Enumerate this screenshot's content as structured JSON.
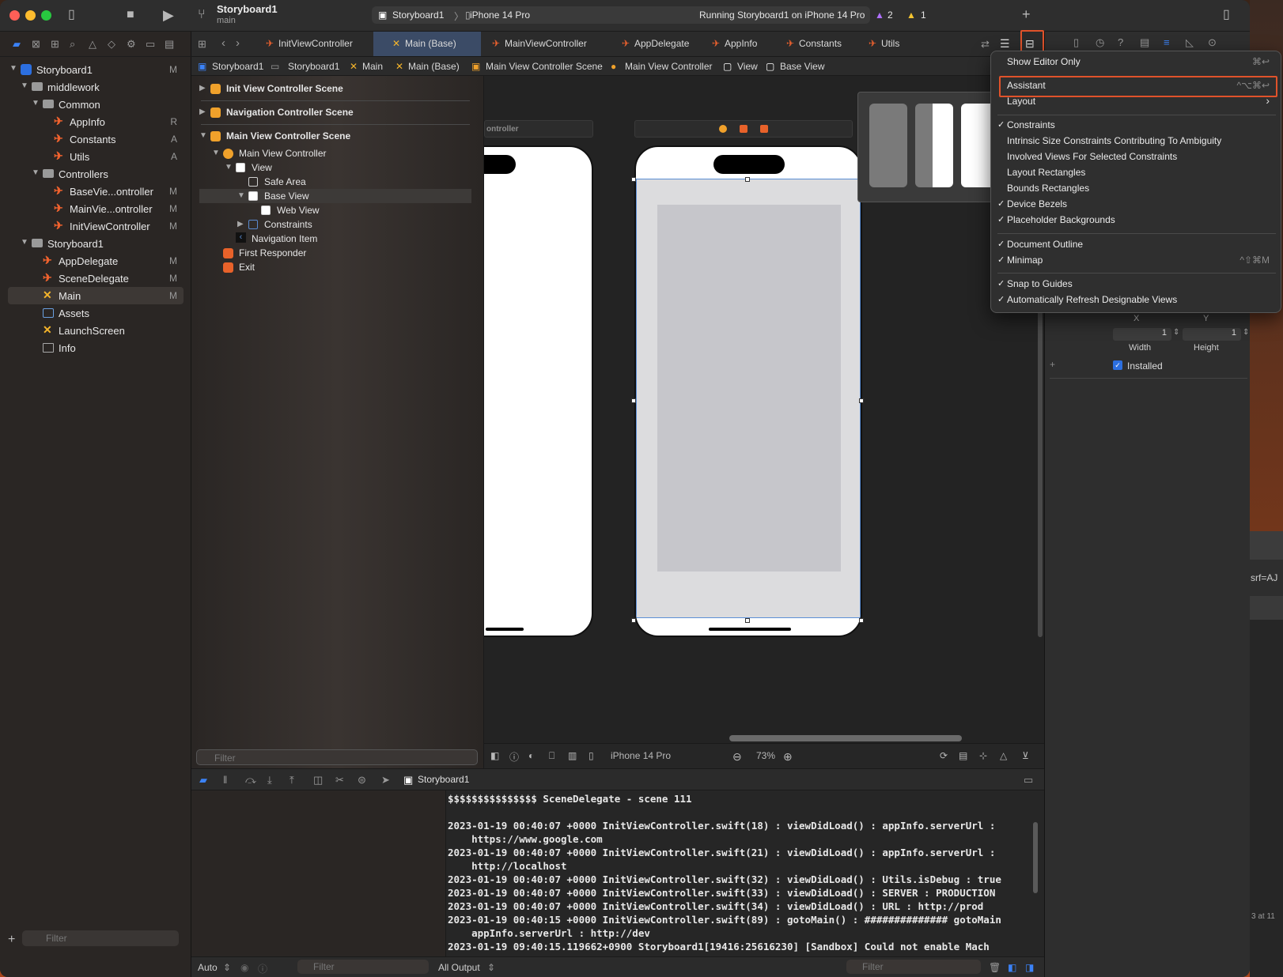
{
  "toolbar": {
    "project_name": "Storyboard1",
    "branch": "main",
    "scheme": "Storyboard1",
    "device": "iPhone 14 Pro",
    "status": "Running Storyboard1 on iPhone 14 Pro",
    "warnings": "2",
    "issues": "1"
  },
  "navigator": {
    "items": [
      {
        "label": "Storyboard1",
        "badge": "M"
      },
      {
        "label": "middlework",
        "badge": ""
      },
      {
        "label": "Common",
        "badge": ""
      },
      {
        "label": "AppInfo",
        "badge": "R"
      },
      {
        "label": "Constants",
        "badge": "A"
      },
      {
        "label": "Utils",
        "badge": "A"
      },
      {
        "label": "Controllers",
        "badge": ""
      },
      {
        "label": "BaseVie...ontroller",
        "badge": "M"
      },
      {
        "label": "MainVie...ontroller",
        "badge": "M"
      },
      {
        "label": "InitViewController",
        "badge": "M"
      },
      {
        "label": "Storyboard1",
        "badge": ""
      },
      {
        "label": "AppDelegate",
        "badge": "M"
      },
      {
        "label": "SceneDelegate",
        "badge": "M"
      },
      {
        "label": "Main",
        "badge": "M"
      },
      {
        "label": "Assets",
        "badge": ""
      },
      {
        "label": "LaunchScreen",
        "badge": ""
      },
      {
        "label": "Info",
        "badge": ""
      }
    ],
    "filter_placeholder": "Filter"
  },
  "tabs": [
    {
      "label": "InitViewController"
    },
    {
      "label": "Main (Base)"
    },
    {
      "label": "MainViewController"
    },
    {
      "label": "AppDelegate"
    },
    {
      "label": "AppInfo"
    },
    {
      "label": "Constants"
    },
    {
      "label": "Utils"
    }
  ],
  "breadcrumb": [
    "Storyboard1",
    "Storyboard1",
    "Main",
    "Main (Base)",
    "Main View Controller Scene",
    "Main View Controller",
    "View",
    "Base View"
  ],
  "outline": {
    "rows": [
      {
        "label": "Init View Controller Scene"
      },
      {
        "label": "Navigation Controller Scene"
      },
      {
        "label": "Main View Controller Scene"
      },
      {
        "label": "Main View Controller"
      },
      {
        "label": "View"
      },
      {
        "label": "Safe Area"
      },
      {
        "label": "Base View"
      },
      {
        "label": "Web View"
      },
      {
        "label": "Constraints"
      },
      {
        "label": "Navigation Item"
      },
      {
        "label": "First Responder"
      },
      {
        "label": "Exit"
      }
    ],
    "filter_placeholder": "Filter"
  },
  "canvas": {
    "left_scene_label": "ontroller",
    "device_label": "iPhone 14 Pro",
    "zoom": "73%"
  },
  "debug": {
    "process": "Storyboard1",
    "console_lines": [
      "$$$$$$$$$$$$$$$ SceneDelegate - scene 111",
      "",
      "2023-01-19 00:40:07 +0000 InitViewController.swift(18) : viewDidLoad() : appInfo.serverUrl :",
      "    https://www.google.com",
      "2023-01-19 00:40:07 +0000 InitViewController.swift(21) : viewDidLoad() : appInfo.serverUrl :",
      "    http://localhost",
      "2023-01-19 00:40:07 +0000 InitViewController.swift(32) : viewDidLoad() : Utils.isDebug : true",
      "2023-01-19 00:40:07 +0000 InitViewController.swift(33) : viewDidLoad() : SERVER : PRODUCTION",
      "2023-01-19 00:40:07 +0000 InitViewController.swift(34) : viewDidLoad() : URL : http://prod",
      "2023-01-19 00:40:15 +0000 InitViewController.swift(89) : gotoMain() : ############## gotoMain",
      "    appInfo.serverUrl : http://dev",
      "2023-01-19 09:40:15.119662+0900 Storyboard1[19416:25616230] [Sandbox] Could not enable Mach"
    ],
    "auto_label": "Auto",
    "output_label": "All Output",
    "filter_placeholder": "Filter"
  },
  "inspector": {
    "x_label": "X",
    "y_label": "Y",
    "width_value": "1",
    "height_value": "1",
    "width_label": "Width",
    "height_label": "Height",
    "installed_label": "Installed",
    "side_text_1": "srf=AJ",
    "side_text_2": "3 at 11"
  },
  "menu": {
    "items": [
      {
        "label": "Show Editor Only",
        "shortcut": "⌘↩",
        "checked": ""
      },
      {
        "label": "Assistant",
        "shortcut": "^⌥⌘↩",
        "checked": ""
      },
      {
        "label": "Layout",
        "shortcut": "›",
        "checked": ""
      },
      {
        "label": "Constraints",
        "shortcut": "",
        "checked": "✓"
      },
      {
        "label": "Intrinsic Size Constraints Contributing To Ambiguity",
        "shortcut": "",
        "checked": ""
      },
      {
        "label": "Involved Views For Selected Constraints",
        "shortcut": "",
        "checked": ""
      },
      {
        "label": "Layout Rectangles",
        "shortcut": "",
        "checked": ""
      },
      {
        "label": "Bounds Rectangles",
        "shortcut": "",
        "checked": ""
      },
      {
        "label": "Device Bezels",
        "shortcut": "",
        "checked": "✓"
      },
      {
        "label": "Placeholder Backgrounds",
        "shortcut": "",
        "checked": "✓"
      },
      {
        "label": "Document Outline",
        "shortcut": "",
        "checked": "✓"
      },
      {
        "label": "Minimap",
        "shortcut": "^⇧⌘M",
        "checked": "✓"
      },
      {
        "label": "Snap to Guides",
        "shortcut": "",
        "checked": "✓"
      },
      {
        "label": "Automatically Refresh Designable Views",
        "shortcut": "",
        "checked": "✓"
      }
    ]
  },
  "colors": {
    "accent": "#3b82f6",
    "highlight": "#e0522a",
    "swift_icon": "#f0622e"
  }
}
